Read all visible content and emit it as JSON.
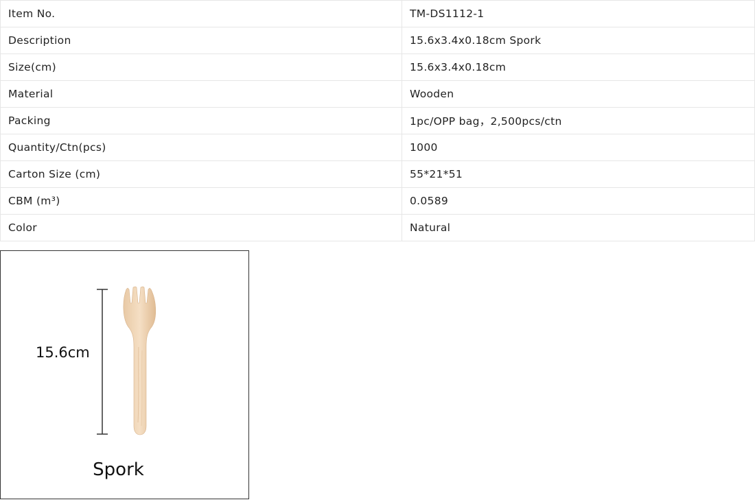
{
  "specs": [
    {
      "label": "Item No.",
      "value": "TM-DS1112-1"
    },
    {
      "label": "Description",
      "value": "15.6x3.4x0.18cm Spork"
    },
    {
      "label": "Size(cm)",
      "value": "15.6x3.4x0.18cm"
    },
    {
      "label": "Material",
      "value": "Wooden"
    },
    {
      "label": "Packing",
      "value": "1pc/OPP bag，2,500pcs/ctn"
    },
    {
      "label": "Quantity/Ctn(pcs)",
      "value": "1000"
    },
    {
      "label": "Carton Size (cm)",
      "value": "55*21*51"
    },
    {
      "label": "CBM (m³)",
      "value": "0.0589"
    },
    {
      "label": "Color",
      "value": "Natural"
    }
  ],
  "product": {
    "dimension_label": "15.6cm",
    "name": "Spork",
    "image_icon": "wooden-spork-icon"
  },
  "colors": {
    "border": "#e6e6e6",
    "card_border": "#333333",
    "wood_light": "#f3dcc0",
    "wood_dark": "#e2bf98",
    "text": "#222222"
  }
}
